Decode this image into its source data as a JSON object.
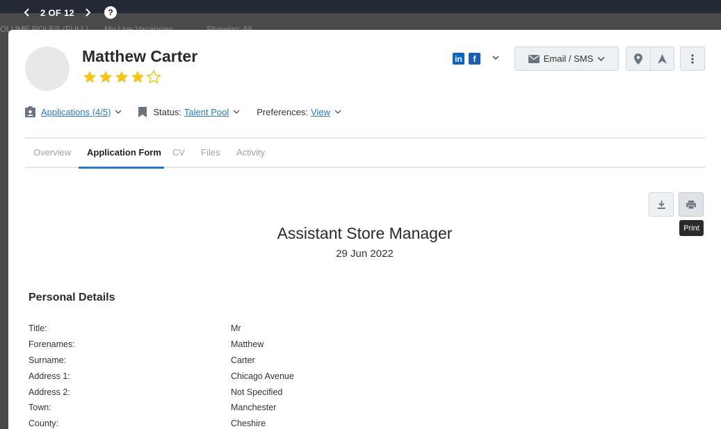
{
  "pager": {
    "text": "2 OF 12",
    "help": "?"
  },
  "background": {
    "subbar": [
      "OLUME ROLES (FULL)",
      "My Live Vacancies",
      "Showing: All"
    ]
  },
  "candidate": {
    "name": "Matthew Carter",
    "rating": 4,
    "rating_max": 5
  },
  "social": {
    "linkedin": "in",
    "facebook": "f"
  },
  "actions": {
    "email_sms": "Email / SMS"
  },
  "info": {
    "applications": "Applications (4/5)",
    "status_label": "Status:",
    "status_value": "Talent Pool",
    "preferences_label": "Preferences:",
    "preferences_value": "View"
  },
  "tabs": [
    {
      "label": "Overview"
    },
    {
      "label": "Application Form"
    },
    {
      "label": "CV"
    },
    {
      "label": "Files"
    },
    {
      "label": "Activity"
    }
  ],
  "active_tab": "Application Form",
  "tooltip": "Print",
  "form": {
    "title": "Assistant Store Manager",
    "date": "29 Jun 2022",
    "section": "Personal Details",
    "fields": [
      {
        "label": "Title:",
        "value": "Mr"
      },
      {
        "label": "Forenames:",
        "value": "Matthew"
      },
      {
        "label": "Surname:",
        "value": "Carter"
      },
      {
        "label": "Address 1:",
        "value": "Chicago Avenue"
      },
      {
        "label": "Address 2:",
        "value": "Not Specified"
      },
      {
        "label": "Town:",
        "value": "Manchester"
      },
      {
        "label": "County:",
        "value": "Cheshire"
      }
    ]
  },
  "colors": {
    "accent": "#2878c8",
    "star": "#f5c518",
    "topbar": "#232a35"
  },
  "icons": [
    "chevron-left-icon",
    "chevron-right-icon",
    "help-icon",
    "star-icon",
    "linkedin-icon",
    "facebook-icon",
    "mail-icon",
    "location-pin-icon",
    "navigation-arrow-icon",
    "more-vertical-icon",
    "clipboard-user-icon",
    "bookmark-icon",
    "download-icon",
    "print-icon"
  ]
}
